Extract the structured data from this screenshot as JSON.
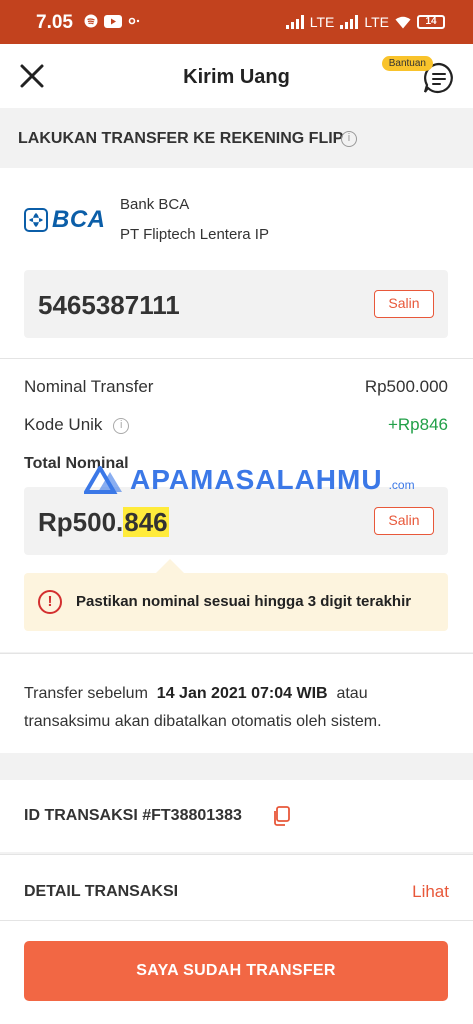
{
  "status_bar": {
    "time": "7.05",
    "network_1": "LTE",
    "network_2": "LTE",
    "battery": "14",
    "icons": [
      "spotify-icon",
      "youtube-icon",
      "cast-icon",
      "signal-icon",
      "wifi-icon",
      "battery-icon"
    ]
  },
  "header": {
    "title": "Kirim Uang",
    "help_badge": "Bantuan",
    "close_icon": "close-icon",
    "help_icon": "chat-help-icon"
  },
  "banner": {
    "text": "LAKUKAN TRANSFER KE REKENING FLIP",
    "info_glyph": "i"
  },
  "bank": {
    "logo_text": "BCA",
    "name": "Bank BCA",
    "owner": "PT Fliptech Lentera IP",
    "account_number": "5465387111",
    "copy_label": "Salin"
  },
  "summary": {
    "nominal_label": "Nominal Transfer",
    "nominal_value": "Rp500.000",
    "kode_label": "Kode Unik",
    "kode_value": "+Rp846",
    "total_label": "Total Nominal",
    "total_prefix": "Rp500.",
    "total_highlight": "846",
    "copy_label": "Salin",
    "warning_glyph": "!",
    "warning": "Pastikan nominal sesuai hingga 3 digit terakhir"
  },
  "watermark": {
    "text": "APAMASALAHMU",
    "suffix": ".com"
  },
  "deadline": {
    "prefix": "Transfer sebelum",
    "datetime": "14 Jan 2021 07:04 WIB",
    "suffix": "atau transaksimu akan dibatalkan otomatis oleh sistem."
  },
  "transaction": {
    "id_label": "ID TRANSAKSI #FT38801383",
    "detail_label": "DETAIL TRANSAKSI",
    "detail_link": "Lihat"
  },
  "footer": {
    "cta_label": "SAYA SUDAH TRANSFER"
  },
  "colors": {
    "status_bar": "#c2421e",
    "accent": "#f26744",
    "success": "#21a048",
    "warning_bg": "#fdf4de",
    "highlight": "#ffeb3b",
    "bca_blue": "#0b5ea8"
  }
}
